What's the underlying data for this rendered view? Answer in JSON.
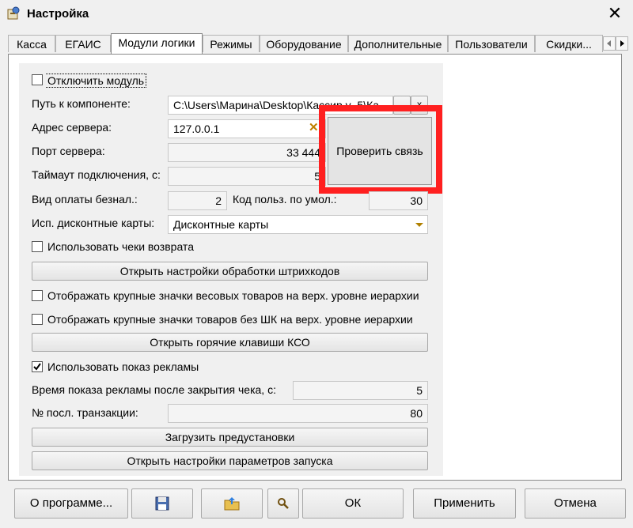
{
  "window": {
    "title": "Настройка",
    "close_icon": "close-icon"
  },
  "tabs": [
    {
      "label": "Касса"
    },
    {
      "label": "ЕГАИС"
    },
    {
      "label": "Модули логики",
      "active": true
    },
    {
      "label": "Режимы"
    },
    {
      "label": "Оборудование"
    },
    {
      "label": "Дополнительные"
    },
    {
      "label": "Пользователи"
    },
    {
      "label": "Скидки..."
    }
  ],
  "module": {
    "disable_label": "Отключить модуль",
    "disable_checked": false,
    "path_label": "Путь к компоненте:",
    "path_value": "C:\\Users\\Марина\\Desktop\\Кассир v_5\\Ка",
    "path_button": "...",
    "path_clear": "x",
    "server_label": "Адрес сервера:",
    "server_value": "127.0.0.1",
    "port_label": "Порт сервера:",
    "port_value": "33 444",
    "timeout_label": "Таймаут подключения, с:",
    "timeout_value": "5",
    "check_button": "Проверить связь",
    "payment_label": "Вид оплаты безнал.:",
    "payment_value": "2",
    "user_code_label": "Код польз. по умол.:",
    "user_code_value": "30",
    "discount_label": "Исп. дисконтные карты:",
    "discount_value": "Дисконтные карты",
    "return_checks_label": "Использовать чеки возврата",
    "return_checks_checked": false,
    "barcode_button": "Открыть настройки обработки штрихкодов",
    "large_weight_icons_label": "Отображать крупные значки весовых товаров на верх. уровне иерархии",
    "large_weight_icons_checked": false,
    "large_nobarcode_icons_label": "Отображать крупные значки товаров без ШК на верх. уровне иерархии",
    "large_nobarcode_icons_checked": false,
    "hotkeys_button": "Открыть горячие клавиши КСО",
    "ads_label": "Использовать показ рекламы",
    "ads_checked": true,
    "ads_time_label": "Время показа рекламы после закрытия чека, с:",
    "ads_time_value": "5",
    "transaction_label": "№ посл. транзакции:",
    "transaction_value": "80",
    "presets_button": "Загрузить предустановки",
    "launch_params_button": "Открыть настройки параметров запуска"
  },
  "footer": {
    "about": "О программе...",
    "save_icon": "floppy-disk-icon",
    "export_icon": "folder-export-icon",
    "search_icon": "search-icon",
    "ok": "ОК",
    "apply": "Применить",
    "cancel": "Отмена"
  },
  "colors": {
    "highlight": "#ff2020",
    "background": "#f0f0f0"
  }
}
